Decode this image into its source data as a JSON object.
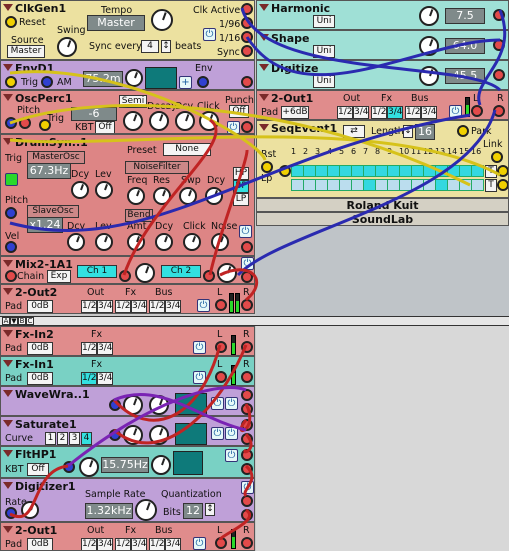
{
  "clkgen": {
    "title": "ClkGen1",
    "reset": "Reset",
    "tempo_label": "Tempo",
    "tempo_value": "Master",
    "clk_active": "Clk Active",
    "ratio1": "1/96",
    "ratio2": "1/16",
    "sync_label": "Sync",
    "swing": "Swing",
    "source_label": "Source",
    "source_value": "Master",
    "sync_every": "Sync every",
    "beats_value": "4",
    "beats_label": "beats"
  },
  "envd": {
    "title": "EnvD1",
    "trig": "Trig",
    "am": "AM",
    "value": "75.2m",
    "env": "Env"
  },
  "oscperc": {
    "title": "OscPerc1",
    "pitch": "Pitch",
    "semi": "Semi",
    "decay": "Decay",
    "dcy": "Dcy",
    "click": "Click",
    "punch": "Punch",
    "trig": "Trig",
    "pitch_value": "-6",
    "kbt": "KBT",
    "off": "Off",
    "punch_off": "Off"
  },
  "drumsyn": {
    "title": "DrumSyn..1",
    "preset": "Preset",
    "preset_value": "None",
    "trig": "Trig",
    "master_osc": "MasterOsc",
    "freq_value": "67.3Hz",
    "dcy": "Dcy",
    "lev": "Lev",
    "noise_filter": "NoiseFilter",
    "freq": "Freq",
    "res": "Res",
    "swp": "Swp",
    "hp": "HP",
    "bp": "BP",
    "lp": "LP",
    "pitch": "Pitch",
    "slave_osc": "SlaveOsc",
    "ratio_value": "x1.24",
    "bend": "Bend",
    "vel": "Vel",
    "amt": "Amt",
    "click": "Click",
    "noise": "Noise"
  },
  "mix": {
    "title": "Mix2-1A1",
    "chain": "Chain",
    "exp": "Exp",
    "ch1": "Ch 1",
    "ch2": "Ch 2"
  },
  "out2": {
    "title": "2-Out2",
    "pad": "Pad",
    "pad_value": "0dB",
    "out": "Out",
    "fx": "Fx",
    "bus": "Bus",
    "opts": [
      "1/2",
      "3/4",
      "1/2",
      "3/4",
      "1/2",
      "3/4"
    ],
    "l": "L",
    "r": "R"
  },
  "harmonic": {
    "title": "Harmonic",
    "uni": "Uni",
    "value": "7.5"
  },
  "shape": {
    "title": "Shape",
    "uni": "Uni",
    "value": "64.0"
  },
  "digitize": {
    "title": "Digitize",
    "uni": "Uni",
    "value": "45.5"
  },
  "out1top": {
    "title": "2-Out1",
    "pad": "Pad",
    "pad_value": "+6dB",
    "out": "Out",
    "fx": "Fx",
    "bus": "Bus",
    "opts": [
      "1/2",
      "3/4",
      "1/2",
      "3/4",
      "1/2",
      "3/4"
    ],
    "l": "L",
    "r": "R"
  },
  "seq": {
    "title": "SeqEvent1",
    "length": "Length",
    "length_value": "16",
    "park": "Park",
    "rst": "Rst",
    "lp": "Lp",
    "link": "Link",
    "steps": [
      "1",
      "2",
      "3",
      "4",
      "5",
      "6",
      "7",
      "8",
      "9",
      "10",
      "11",
      "12",
      "13",
      "14",
      "15",
      "16"
    ],
    "row1": [
      1,
      1,
      1,
      1,
      1,
      1,
      1,
      1,
      1,
      1,
      1,
      1,
      1,
      1,
      1,
      1
    ],
    "row2": [
      0,
      0,
      0,
      0,
      0,
      0,
      1,
      0,
      0,
      0,
      0,
      0,
      1,
      0,
      0,
      0
    ],
    "t": "T"
  },
  "kuit": {
    "title": "Roland Kuit"
  },
  "soundlab": {
    "title": "SoundLab"
  },
  "fxin2": {
    "title": "Fx-In2",
    "pad": "Pad",
    "pad_value": "0dB",
    "fx": "Fx",
    "opts": [
      "1/2",
      "3/4"
    ],
    "l": "L",
    "r": "R"
  },
  "fxin1": {
    "title": "Fx-In1",
    "pad": "Pad",
    "pad_value": "0dB",
    "fx": "Fx",
    "opts": [
      "1/2",
      "3/4"
    ],
    "l": "L",
    "r": "R"
  },
  "wave": {
    "title": "WaveWra..1"
  },
  "sat": {
    "title": "Saturate1",
    "curve": "Curve",
    "opts": [
      "1",
      "2",
      "3",
      "4"
    ]
  },
  "flt": {
    "title": "FltHP1",
    "kbt": "KBT",
    "off": "Off",
    "freq_value": "15.75Hz"
  },
  "dig": {
    "title": "Digitizer1",
    "sample_rate": "Sample Rate",
    "sr_value": "1.32kHz",
    "quant": "Quantization",
    "bits": "Bits",
    "bits_value": "12",
    "rate": "Rate"
  },
  "out1bot": {
    "title": "2-Out1",
    "pad": "Pad",
    "pad_value": "0dB",
    "out": "Out",
    "fx": "Fx",
    "bus": "Bus",
    "opts": [
      "1/2",
      "3/4",
      "1/2",
      "3/4",
      "1/2",
      "3/4"
    ],
    "l": "L",
    "r": "R"
  },
  "toolbar": {
    "icons": [
      "A",
      "▼",
      "B",
      "C"
    ]
  },
  "colors": {
    "red": "#e08c8c",
    "teal": "#79d1c4",
    "violet": "#bfa0d8",
    "yellow": "#ece1a0",
    "cable_blue": "#2a2ab0",
    "cable_red": "#c02424",
    "cable_yellow": "#d6c21a",
    "cable_violet": "#7a24b4"
  }
}
